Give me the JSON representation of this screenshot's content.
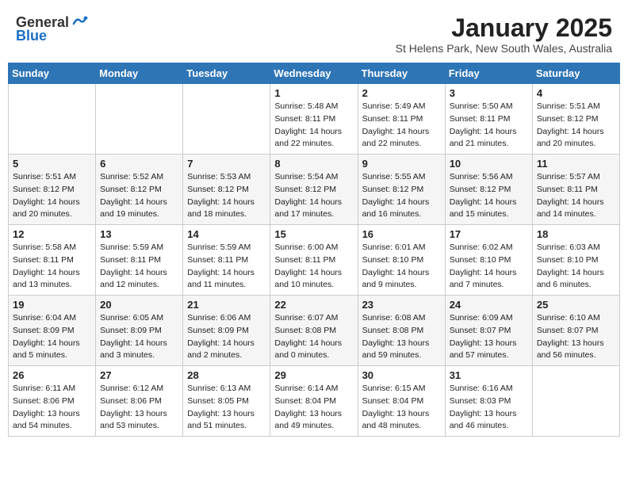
{
  "header": {
    "logo_general": "General",
    "logo_blue": "Blue",
    "month_title": "January 2025",
    "subtitle": "St Helens Park, New South Wales, Australia"
  },
  "days_of_week": [
    "Sunday",
    "Monday",
    "Tuesday",
    "Wednesday",
    "Thursday",
    "Friday",
    "Saturday"
  ],
  "weeks": [
    [
      {
        "day": "",
        "info": ""
      },
      {
        "day": "",
        "info": ""
      },
      {
        "day": "",
        "info": ""
      },
      {
        "day": "1",
        "info": "Sunrise: 5:48 AM\nSunset: 8:11 PM\nDaylight: 14 hours\nand 22 minutes."
      },
      {
        "day": "2",
        "info": "Sunrise: 5:49 AM\nSunset: 8:11 PM\nDaylight: 14 hours\nand 22 minutes."
      },
      {
        "day": "3",
        "info": "Sunrise: 5:50 AM\nSunset: 8:11 PM\nDaylight: 14 hours\nand 21 minutes."
      },
      {
        "day": "4",
        "info": "Sunrise: 5:51 AM\nSunset: 8:12 PM\nDaylight: 14 hours\nand 20 minutes."
      }
    ],
    [
      {
        "day": "5",
        "info": "Sunrise: 5:51 AM\nSunset: 8:12 PM\nDaylight: 14 hours\nand 20 minutes."
      },
      {
        "day": "6",
        "info": "Sunrise: 5:52 AM\nSunset: 8:12 PM\nDaylight: 14 hours\nand 19 minutes."
      },
      {
        "day": "7",
        "info": "Sunrise: 5:53 AM\nSunset: 8:12 PM\nDaylight: 14 hours\nand 18 minutes."
      },
      {
        "day": "8",
        "info": "Sunrise: 5:54 AM\nSunset: 8:12 PM\nDaylight: 14 hours\nand 17 minutes."
      },
      {
        "day": "9",
        "info": "Sunrise: 5:55 AM\nSunset: 8:12 PM\nDaylight: 14 hours\nand 16 minutes."
      },
      {
        "day": "10",
        "info": "Sunrise: 5:56 AM\nSunset: 8:12 PM\nDaylight: 14 hours\nand 15 minutes."
      },
      {
        "day": "11",
        "info": "Sunrise: 5:57 AM\nSunset: 8:11 PM\nDaylight: 14 hours\nand 14 minutes."
      }
    ],
    [
      {
        "day": "12",
        "info": "Sunrise: 5:58 AM\nSunset: 8:11 PM\nDaylight: 14 hours\nand 13 minutes."
      },
      {
        "day": "13",
        "info": "Sunrise: 5:59 AM\nSunset: 8:11 PM\nDaylight: 14 hours\nand 12 minutes."
      },
      {
        "day": "14",
        "info": "Sunrise: 5:59 AM\nSunset: 8:11 PM\nDaylight: 14 hours\nand 11 minutes."
      },
      {
        "day": "15",
        "info": "Sunrise: 6:00 AM\nSunset: 8:11 PM\nDaylight: 14 hours\nand 10 minutes."
      },
      {
        "day": "16",
        "info": "Sunrise: 6:01 AM\nSunset: 8:10 PM\nDaylight: 14 hours\nand 9 minutes."
      },
      {
        "day": "17",
        "info": "Sunrise: 6:02 AM\nSunset: 8:10 PM\nDaylight: 14 hours\nand 7 minutes."
      },
      {
        "day": "18",
        "info": "Sunrise: 6:03 AM\nSunset: 8:10 PM\nDaylight: 14 hours\nand 6 minutes."
      }
    ],
    [
      {
        "day": "19",
        "info": "Sunrise: 6:04 AM\nSunset: 8:09 PM\nDaylight: 14 hours\nand 5 minutes."
      },
      {
        "day": "20",
        "info": "Sunrise: 6:05 AM\nSunset: 8:09 PM\nDaylight: 14 hours\nand 3 minutes."
      },
      {
        "day": "21",
        "info": "Sunrise: 6:06 AM\nSunset: 8:09 PM\nDaylight: 14 hours\nand 2 minutes."
      },
      {
        "day": "22",
        "info": "Sunrise: 6:07 AM\nSunset: 8:08 PM\nDaylight: 14 hours\nand 0 minutes."
      },
      {
        "day": "23",
        "info": "Sunrise: 6:08 AM\nSunset: 8:08 PM\nDaylight: 13 hours\nand 59 minutes."
      },
      {
        "day": "24",
        "info": "Sunrise: 6:09 AM\nSunset: 8:07 PM\nDaylight: 13 hours\nand 57 minutes."
      },
      {
        "day": "25",
        "info": "Sunrise: 6:10 AM\nSunset: 8:07 PM\nDaylight: 13 hours\nand 56 minutes."
      }
    ],
    [
      {
        "day": "26",
        "info": "Sunrise: 6:11 AM\nSunset: 8:06 PM\nDaylight: 13 hours\nand 54 minutes."
      },
      {
        "day": "27",
        "info": "Sunrise: 6:12 AM\nSunset: 8:06 PM\nDaylight: 13 hours\nand 53 minutes."
      },
      {
        "day": "28",
        "info": "Sunrise: 6:13 AM\nSunset: 8:05 PM\nDaylight: 13 hours\nand 51 minutes."
      },
      {
        "day": "29",
        "info": "Sunrise: 6:14 AM\nSunset: 8:04 PM\nDaylight: 13 hours\nand 49 minutes."
      },
      {
        "day": "30",
        "info": "Sunrise: 6:15 AM\nSunset: 8:04 PM\nDaylight: 13 hours\nand 48 minutes."
      },
      {
        "day": "31",
        "info": "Sunrise: 6:16 AM\nSunset: 8:03 PM\nDaylight: 13 hours\nand 46 minutes."
      },
      {
        "day": "",
        "info": ""
      }
    ]
  ]
}
